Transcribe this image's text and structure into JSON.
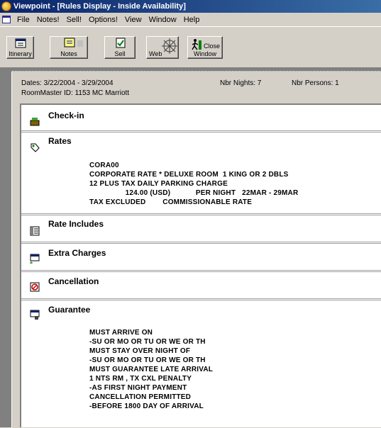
{
  "window": {
    "title": "Viewpoint - [Rules Display - Inside Availability]"
  },
  "menu": [
    "File",
    "Notes!",
    "Sell!",
    "Options!",
    "View",
    "Window",
    "Help"
  ],
  "toolbar": {
    "itinerary": "Itinerary",
    "notes": "Notes",
    "sell": "Sell",
    "web": "Web",
    "close_line1": "Close",
    "close_line2": "Window"
  },
  "info": {
    "dates": "Dates:  3/22/2004 - 3/29/2004",
    "roommaster": "RoomMaster ID:  1153    MC   Marriott",
    "nights": "Nbr Nights:  7",
    "persons": "Nbr Persons:  1"
  },
  "sections": {
    "checkin": "Check-in",
    "rates": "Rates",
    "rate_includes": "Rate Includes",
    "extra_charges": "Extra Charges",
    "cancellation": "Cancellation",
    "guarantee": "Guarantee"
  },
  "rates_lines": [
    "CORA00",
    "CORPORATE RATE * DELUXE ROOM  1 KING OR 2 DBLS",
    "12 PLUS TAX DAILY PARKING CHARGE",
    "                 124.00 (USD)            PER NIGHT   22MAR - 29MAR",
    "TAX EXCLUDED        COMMISSIONABLE RATE"
  ],
  "guarantee_lines": [
    "MUST ARRIVE ON",
    "-SU OR MO OR TU OR WE OR TH",
    "MUST STAY OVER NIGHT OF",
    "-SU OR MO OR TU OR WE OR TH",
    "MUST GUARANTEE LATE ARRIVAL",
    "1 NTS RM , TX CXL PENALTY",
    "-AS FIRST NIGHT PAYMENT",
    "CANCELLATION PERMITTED",
    "-BEFORE 1800 DAY OF ARRIVAL"
  ],
  "colors": {
    "titlebar": "#0a246a",
    "chrome": "#d4d0c8",
    "content": "#ffffff"
  }
}
